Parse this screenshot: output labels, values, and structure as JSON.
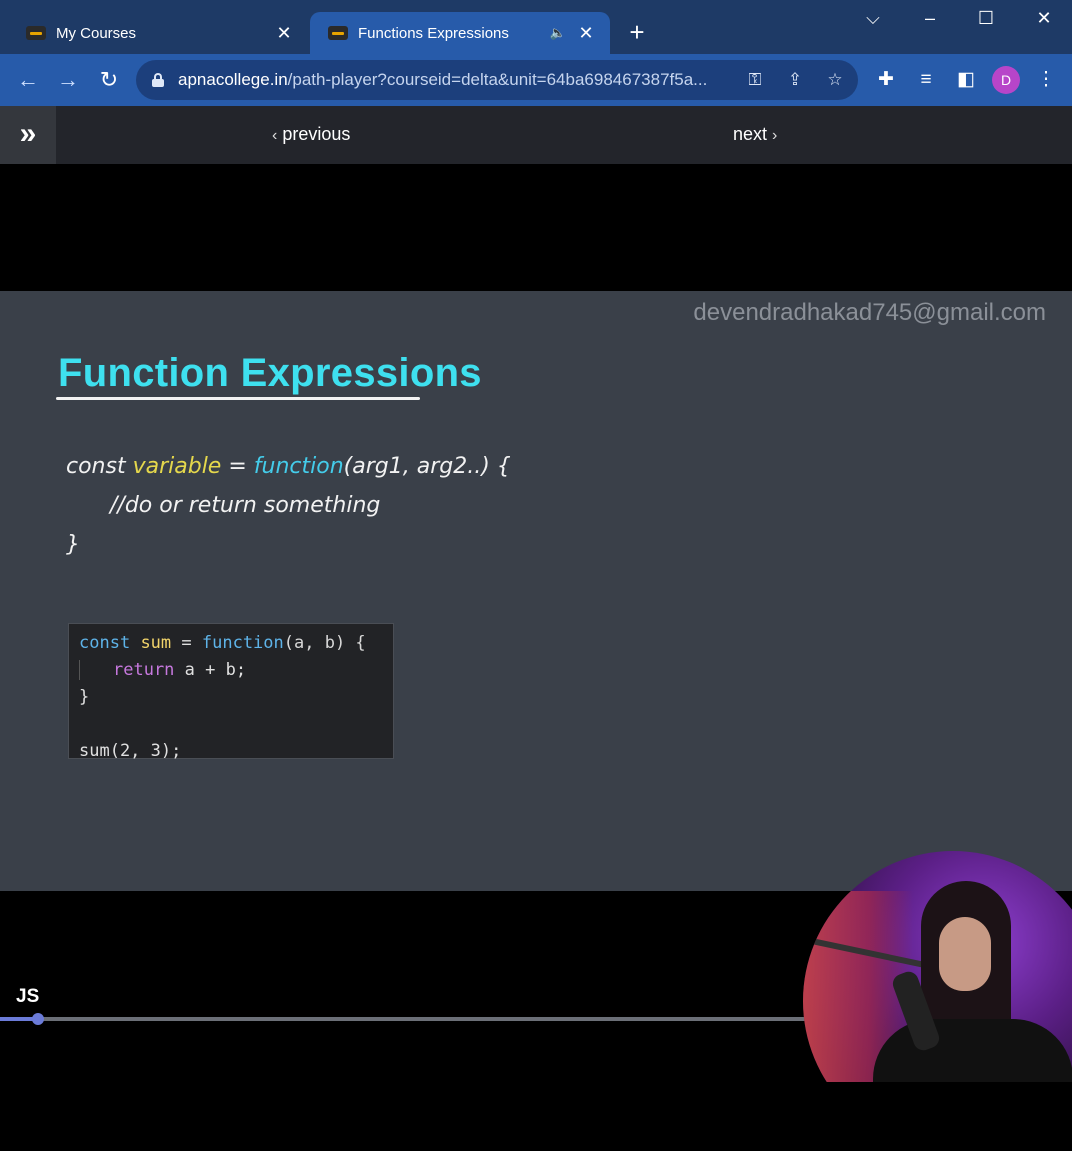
{
  "browser": {
    "tabs": [
      {
        "title": "My Courses",
        "active": false
      },
      {
        "title": "Functions Expressions",
        "active": true,
        "audio": true
      }
    ],
    "url_host": "apnacollege.in",
    "url_rest": "/path-player?courseid=delta&unit=64ba698467387f5a...",
    "profile_initial": "D",
    "accent": "#275baa"
  },
  "course_nav": {
    "previous_label": "previous",
    "next_label": "next"
  },
  "slide": {
    "watermark": "devendradhakad745@gmail.com",
    "title": "Function Expressions",
    "syntax": {
      "const": "const",
      "variable": "variable",
      "equals": " = ",
      "function": "function",
      "args": "(arg1, arg2..) {",
      "body": "//do or return something",
      "close": "}"
    },
    "code": {
      "l1_const": "const",
      "l1_sum": "sum",
      "l1_eq": " = ",
      "l1_fn": "function",
      "l1_args": "(a, b) {",
      "l2_return": "return",
      "l2_expr": " a + b;",
      "l3": "}",
      "l5": "sum(2, 3);"
    },
    "logo": "JS"
  },
  "player": {
    "progress_fraction": 0.035
  }
}
